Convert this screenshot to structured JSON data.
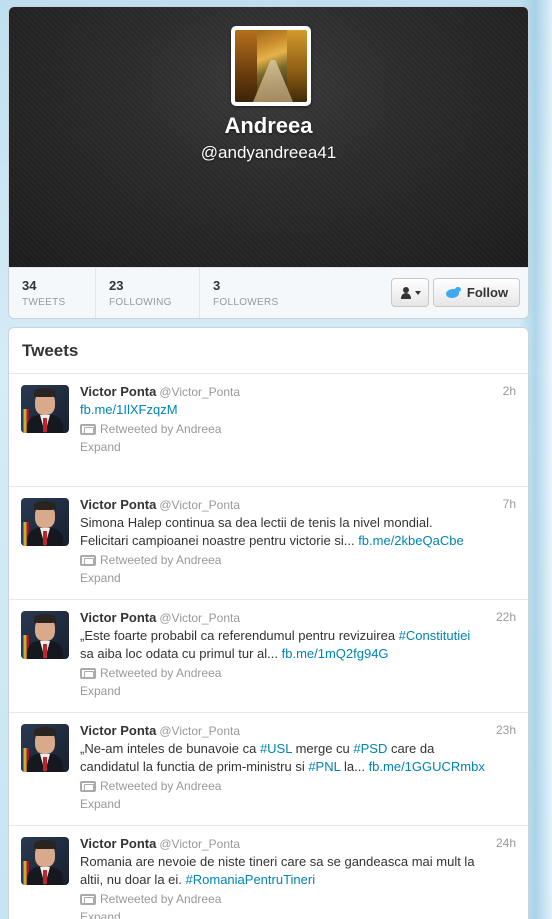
{
  "profile": {
    "name": "Andreea",
    "handle": "@andyandreea41",
    "avatar_icon": "autumn-forest-path-photo"
  },
  "stats": [
    {
      "count": "34",
      "label": "TWEETS"
    },
    {
      "count": "23",
      "label": "FOLLOWING"
    },
    {
      "count": "3",
      "label": "FOLLOWERS"
    }
  ],
  "actions": {
    "user_dropdown_icon": "person-icon",
    "follow_label": "Follow",
    "follow_icon": "twitter-bird-icon"
  },
  "tweets_heading": "Tweets",
  "tweets": [
    {
      "author": "Victor Ponta",
      "handle": "@Victor_Ponta",
      "time": "2h",
      "text_lines": [
        [
          {
            "t": "fb.me/1IlXFzqzM",
            "link": true
          }
        ]
      ],
      "retweeted_by": "Retweeted by Andreea",
      "expand": "Expand"
    },
    {
      "author": "Victor Ponta",
      "handle": "@Victor_Ponta",
      "time": "7h",
      "text_lines": [
        [
          {
            "t": "Simona Halep continua sa dea lectii de tenis la nivel mondial.",
            "link": false
          }
        ],
        [
          {
            "t": "Felicitari campioanei noastre pentru victorie si... ",
            "link": false
          },
          {
            "t": "fb.me/2kbeQaCbe",
            "link": true
          }
        ]
      ],
      "retweeted_by": "Retweeted by Andreea",
      "expand": "Expand"
    },
    {
      "author": "Victor Ponta",
      "handle": "@Victor_Ponta",
      "time": "22h",
      "text_lines": [
        [
          {
            "t": "„Este foarte probabil ca referendumul pentru revizuirea ",
            "link": false
          },
          {
            "t": "#Constitutiei",
            "link": true
          }
        ],
        [
          {
            "t": "sa aiba loc odata cu primul tur al... ",
            "link": false
          },
          {
            "t": "fb.me/1mQ2fg94G",
            "link": true
          }
        ]
      ],
      "retweeted_by": "Retweeted by Andreea",
      "expand": "Expand"
    },
    {
      "author": "Victor Ponta",
      "handle": "@Victor_Ponta",
      "time": "23h",
      "text_lines": [
        [
          {
            "t": "„Ne-am inteles de bunavoie ca ",
            "link": false
          },
          {
            "t": "#USL",
            "link": true
          },
          {
            "t": " merge cu ",
            "link": false
          },
          {
            "t": "#PSD",
            "link": true
          },
          {
            "t": " care da",
            "link": false
          }
        ],
        [
          {
            "t": "candidatul la functia de prim-ministru si ",
            "link": false
          },
          {
            "t": "#PNL",
            "link": true
          },
          {
            "t": " la... ",
            "link": false
          },
          {
            "t": "fb.me/1GGUCRmbx",
            "link": true
          }
        ]
      ],
      "retweeted_by": "Retweeted by Andreea",
      "expand": "Expand"
    },
    {
      "author": "Victor Ponta",
      "handle": "@Victor_Ponta",
      "time": "24h",
      "text_lines": [
        [
          {
            "t": "Romania are nevoie de niste tineri care sa se gandeasca mai mult la",
            "link": false
          }
        ],
        [
          {
            "t": "altii, nu doar la ei. ",
            "link": false
          },
          {
            "t": "#RomaniaPentruTineri",
            "link": true
          }
        ]
      ],
      "retweeted_by": "Retweeted by Andreea",
      "expand": "Expand"
    }
  ],
  "colors": {
    "link": "#0084b4",
    "muted": "#999999",
    "page_bg": "#c0deed",
    "twitter_blue": "#3ea9ef"
  }
}
